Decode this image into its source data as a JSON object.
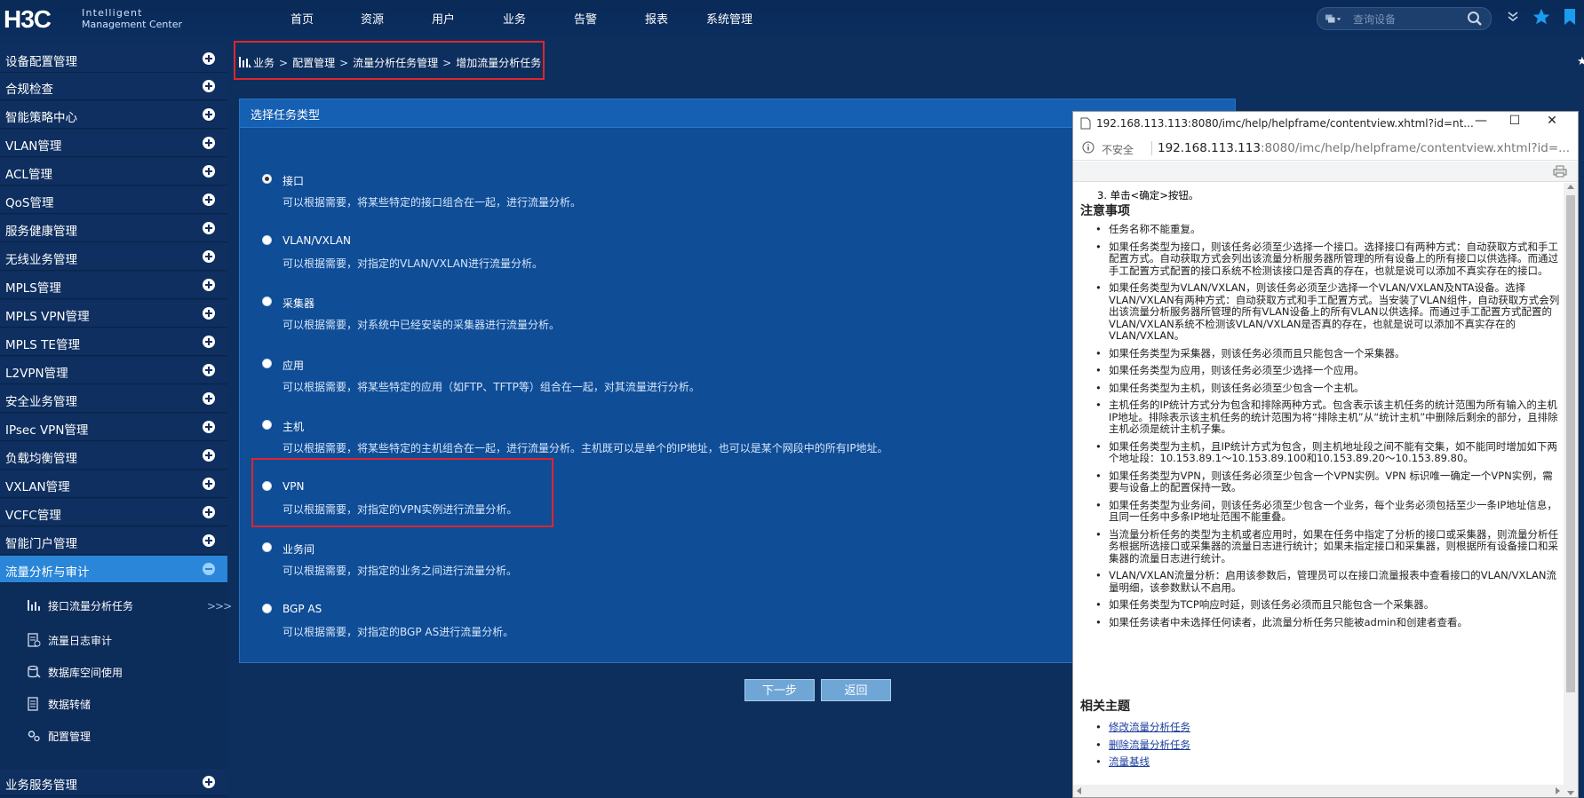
{
  "logo": {
    "brand": "H3C",
    "line1": "Intelligent",
    "line2": "Management Center"
  },
  "topnav": [
    "首页",
    "资源",
    "用户",
    "业务",
    "告警",
    "报表",
    "系统管理"
  ],
  "search": {
    "placeholder": "查询设备"
  },
  "sidebar": {
    "items": [
      {
        "label": "设备配置管理"
      },
      {
        "label": "合规检查"
      },
      {
        "label": "智能策略中心"
      },
      {
        "label": "VLAN管理"
      },
      {
        "label": "ACL管理"
      },
      {
        "label": "QoS管理"
      },
      {
        "label": "服务健康管理"
      },
      {
        "label": "无线业务管理"
      },
      {
        "label": "MPLS管理"
      },
      {
        "label": "MPLS VPN管理"
      },
      {
        "label": "MPLS TE管理"
      },
      {
        "label": "L2VPN管理"
      },
      {
        "label": "安全业务管理"
      },
      {
        "label": "IPsec VPN管理"
      },
      {
        "label": "负载均衡管理"
      },
      {
        "label": "VXLAN管理"
      },
      {
        "label": "VCFC管理"
      },
      {
        "label": "智能门户管理"
      }
    ],
    "active": {
      "label": "流量分析与审计"
    },
    "subitems": [
      {
        "label": "接口流量分析任务"
      },
      {
        "label": "流量日志审计"
      },
      {
        "label": "数据库空间使用"
      },
      {
        "label": "数据转储"
      },
      {
        "label": "配置管理"
      }
    ],
    "expand": ">>>",
    "bottom": {
      "label": "业务服务管理"
    }
  },
  "breadcrumb": [
    "业务",
    "配置管理",
    "流量分析任务管理",
    "增加流量分析任务"
  ],
  "panel": {
    "header": "选择任务类型",
    "selected": "接口",
    "options": [
      {
        "title": "接口",
        "desc": "可以根据需要，将某些特定的接口组合在一起，进行流量分析。"
      },
      {
        "title": "VLAN/VXLAN",
        "desc": "可以根据需要，对指定的VLAN/VXLAN进行流量分析。"
      },
      {
        "title": "采集器",
        "desc": "可以根据需要，对系统中已经安装的采集器进行流量分析。"
      },
      {
        "title": "应用",
        "desc": "可以根据需要，将某些特定的应用（如FTP、TFTP等）组合在一起，对其流量进行分析。"
      },
      {
        "title": "主机",
        "desc": "可以根据需要，将某些特定的主机组合在一起，进行流量分析。主机既可以是单个的IP地址，也可以是某个网段中的所有IP地址。"
      },
      {
        "title": "VPN",
        "desc": "可以根据需要，对指定的VPN实例进行流量分析。"
      },
      {
        "title": "业务间",
        "desc": "可以根据需要，对指定的业务之间进行流量分析。"
      },
      {
        "title": "BGP AS",
        "desc": "可以根据需要，对指定的BGP AS进行流量分析。"
      }
    ],
    "next_btn": "下一步",
    "back_btn": "返回"
  },
  "help": {
    "window_title": "192.168.113.113:8080/imc/help/helpframe/contentview.xhtml?id=nt...",
    "insecure": "不安全",
    "url_host": "192.168.113.113",
    "url_rest": ":8080/imc/help/helpframe/contentview.xhtml?id=...",
    "step3": "3. 单击<确定>按钮。",
    "notes_heading": "注意事项",
    "notes": [
      "任务名称不能重复。",
      "如果任务类型为接口，则该任务必须至少选择一个接口。选择接口有两种方式：自动获取方式和手工配置方式。自动获取方式会列出该流量分析服务器所管理的所有设备上的所有接口以供选择。而通过手工配置方式配置的接口系统不检测该接口是否真的存在，也就是说可以添加不真实存在的接口。",
      "如果任务类型为VLAN/VXLAN，则该任务必须至少选择一个VLAN/VXLAN及NTA设备。选择VLAN/VXLAN有两种方式：自动获取方式和手工配置方式。当安装了VLAN组件，自动获取方式会列出该流量分析服务器所管理的所有VLAN设备上的所有VLAN以供选择。而通过手工配置方式配置的VLAN/VXLAN系统不检测该VLAN/VXLAN是否真的存在，也就是说可以添加不真实存在的VLAN/VXLAN。",
      "如果任务类型为采集器，则该任务必须而且只能包含一个采集器。",
      "如果任务类型为应用，则该任务必须至少选择一个应用。",
      "如果任务类型为主机，则该任务必须至少包含一个主机。",
      "主机任务的IP统计方式分为包含和排除两种方式。包含表示该主机任务的统计范围为所有输入的主机IP地址。排除表示该主机任务的统计范围为将“排除主机”从“统计主机”中删除后剩余的部分，且排除主机必须是统计主机子集。",
      "如果任务类型为主机，且IP统计方式为包含，则主机地址段之间不能有交集，如不能同时增加如下两个地址段：10.153.89.1～10.153.89.100和10.153.89.20～10.153.89.80。",
      "如果任务类型为VPN，则该任务必须至少包含一个VPN实例。VPN 标识唯一确定一个VPN实例，需要与设备上的配置保持一致。",
      "如果任务类型为业务间，则该任务必须至少包含一个业务，每个业务必须包括至少一条IP地址信息，且同一任务中多条IP地址范围不能重叠。",
      "当流量分析任务的类型为主机或者应用时，如果在任务中指定了分析的接口或采集器，则流量分析任务根据所选接口或采集器的流量日志进行统计；如果未指定接口和采集器，则根据所有设备接口和采集器的流量日志进行统计。",
      "VLAN/VXLAN流量分析：启用该参数后，管理员可以在接口流量报表中查看接口的VLAN/VXLAN流量明细，该参数默认不启用。",
      "如果任务类型为TCP响应时延，则该任务必须而且只能包含一个采集器。",
      "如果任务读者中未选择任何读者，此流量分析任务只能被admin和创建者查看。"
    ],
    "related_heading": "相关主题",
    "related": [
      "修改流量分析任务",
      "删除流量分析任务",
      "流量基线"
    ]
  }
}
